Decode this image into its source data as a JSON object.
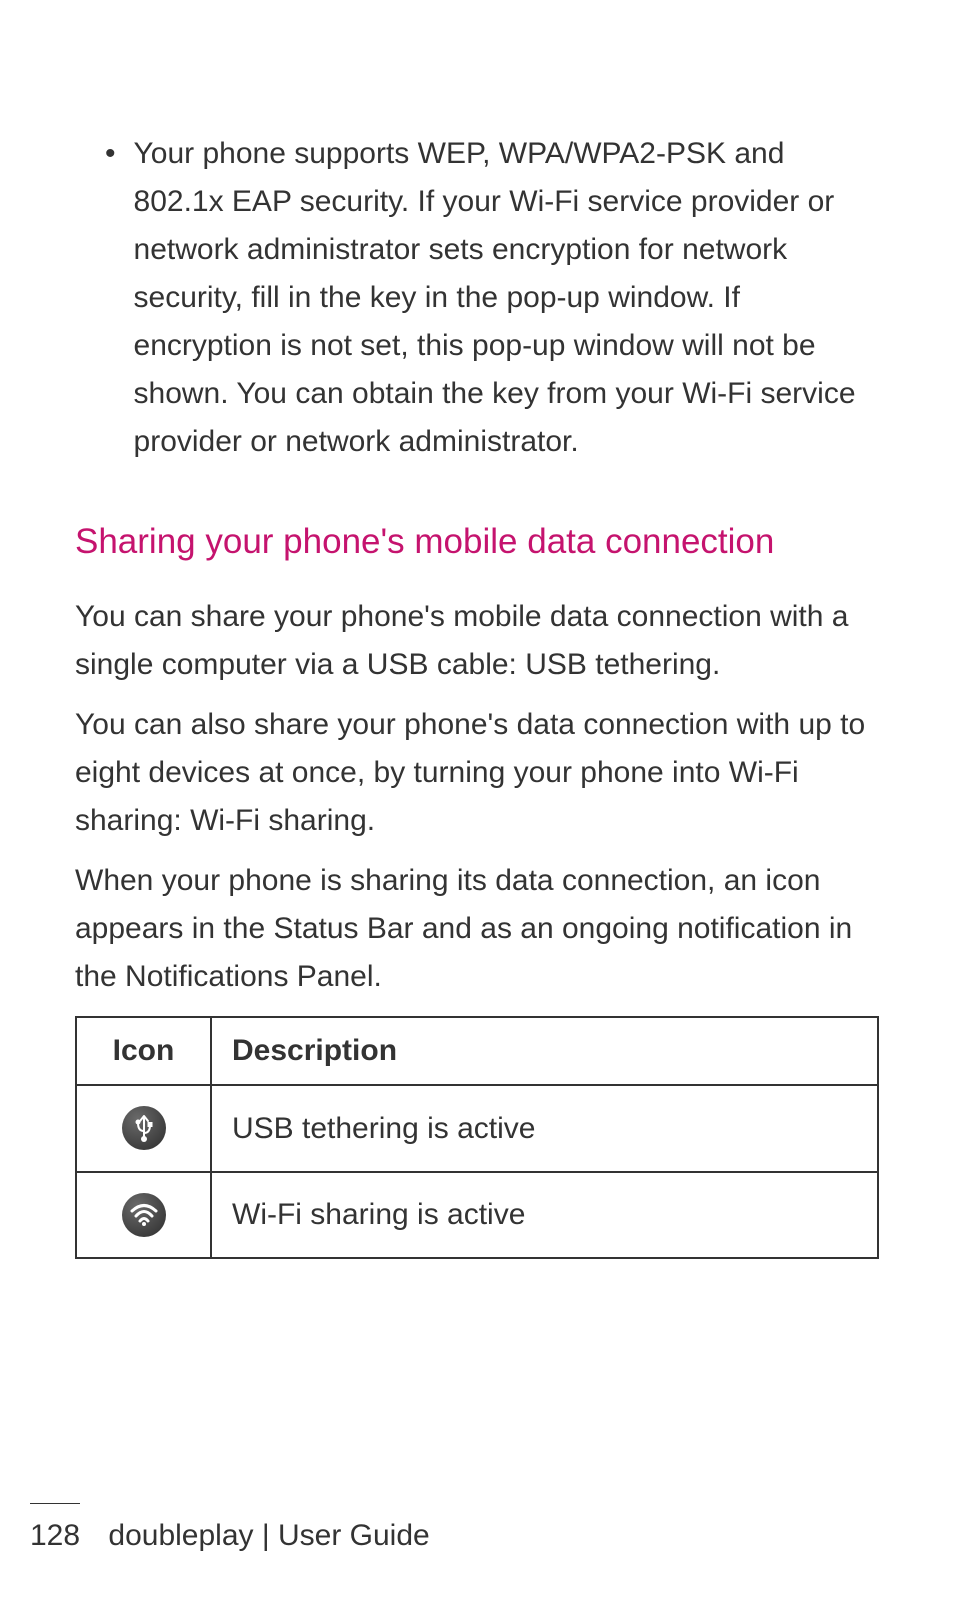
{
  "bullet": {
    "symbol": "•",
    "text": "Your phone supports WEP, WPA/WPA2-PSK and 802.1x EAP security. If your Wi-Fi service provider or network administrator sets encryption for network security, fill in the key in the pop-up window. If encryption is not set, this pop-up window will not be shown. You can obtain the key from your Wi-Fi service provider or network administrator."
  },
  "heading": "Sharing your phone's mobile data connection",
  "paragraphs": {
    "p1": "You can share your phone's mobile data connection with a single computer via a USB cable: USB tethering.",
    "p2": "You can also share your phone's data connection with up to eight devices at once, by turning your phone into Wi-Fi sharing: Wi-Fi sharing.",
    "p3": "When your phone is sharing its data connection, an icon appears in the Status Bar and as an ongoing notification in the Notifications Panel."
  },
  "table": {
    "headers": {
      "icon": "Icon",
      "description": "Description"
    },
    "rows": [
      {
        "icon_name": "usb-icon",
        "description": "USB tethering is active"
      },
      {
        "icon_name": "wifi-icon",
        "description": "Wi-Fi sharing is active"
      }
    ]
  },
  "footer": {
    "page_number": "128",
    "title": "doubleplay  |  User Guide"
  }
}
